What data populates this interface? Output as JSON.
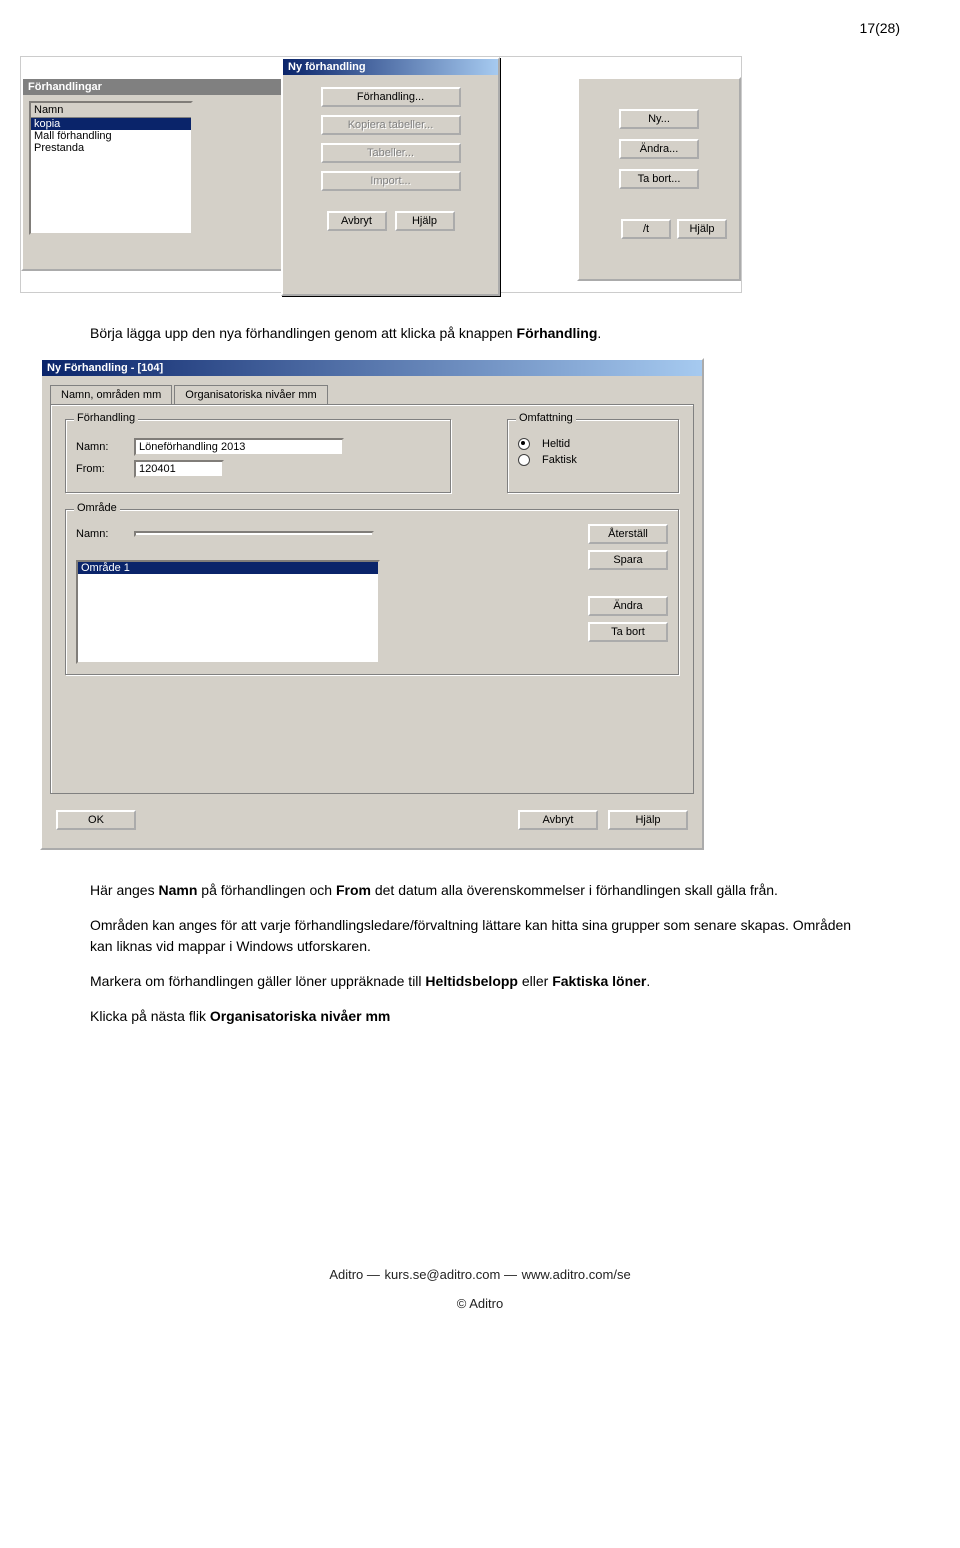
{
  "page_number": "17(28)",
  "shot1": {
    "back_window_title": "Förhandlingar",
    "list_header": "Namn",
    "list_items": [
      "kopia",
      "Mall förhandling",
      "Prestanda"
    ],
    "front_window_title": "Ny förhandling",
    "front_buttons": {
      "forhandling": "Förhandling...",
      "kopiera": "Kopiera tabeller...",
      "tabeller": "Tabeller...",
      "import": "Import..."
    },
    "front_bottom": {
      "avbryt": "Avbryt",
      "hjalp": "Hjälp"
    },
    "mid_buttons": {
      "ny": "Ny...",
      "andra": "Ändra...",
      "tabort": "Ta bort..."
    },
    "mid_bottom": {
      "avbryt_cut": "/t",
      "hjalp": "Hjälp"
    }
  },
  "text1": {
    "p1a": "Börja lägga upp den nya förhandlingen genom att klicka på knappen ",
    "p1b": "Förhandling",
    "p1c": "."
  },
  "shot2": {
    "window_title": "Ny Förhandling - [104]",
    "tab1": "Namn, områden mm",
    "tab2": "Organisatoriska nivåer mm",
    "group_forhandling": "Förhandling",
    "lbl_namn": "Namn:",
    "val_namn": "Löneförhandling 2013",
    "lbl_from": "From:",
    "val_from": "120401",
    "group_omfattning": "Omfattning",
    "radio_heltid": "Heltid",
    "radio_faktisk": "Faktisk",
    "group_omrade": "Område",
    "omrade_lbl_namn": "Namn:",
    "omrade_val": "",
    "omrade_list_item": "Område 1",
    "btn_aterstall": "Återställ",
    "btn_spara": "Spara",
    "btn_andra": "Ändra",
    "btn_tabort": "Ta bort",
    "btn_ok": "OK",
    "btn_avbryt": "Avbryt",
    "btn_hjalp": "Hjälp"
  },
  "text2": {
    "p2a": "Här anges ",
    "p2b": "Namn",
    "p2c": " på förhandlingen och ",
    "p2d": "From",
    "p2e": " det datum alla överenskommelser i förhandlingen skall gälla från.",
    "p3": "Områden kan anges för att varje förhandlingsledare/förvaltning lättare kan hitta sina grupper som senare skapas. Områden kan liknas vid mappar i Windows utforskaren.",
    "p4a": "Markera om förhandlingen gäller löner uppräknade till ",
    "p4b": "Heltidsbelopp",
    "p4c": " eller ",
    "p4d": "Faktiska löner",
    "p4e": ".",
    "p5a": "Klicka på nästa flik ",
    "p5b": "Organisatoriska nivåer mm"
  },
  "footer": {
    "line1a": "Aditro",
    "sep": "—",
    "line1b": "kurs.se@aditro.com",
    "line1c": "www.aditro.com/se",
    "line2": "© Aditro"
  }
}
